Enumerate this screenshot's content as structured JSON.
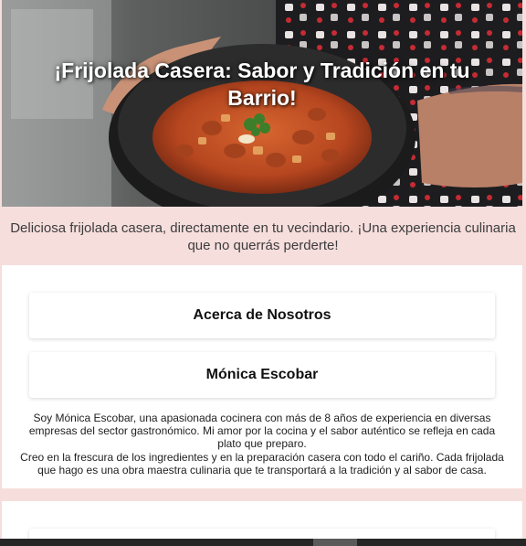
{
  "hero": {
    "title": "¡Frijolada Casera: Sabor y Tradición en tu Barrio!",
    "image_icon": "bowl-of-beans-photo"
  },
  "tagline": "Deliciosa frijolada casera, directamente en tu vecindario. ¡Una experiencia culinaria que no querrás perderte!",
  "sections": {
    "about_label": "Acerca de Nosotros",
    "chef_label": "Mónica Escobar"
  },
  "bio": {
    "p1": "Soy Mónica Escobar, una apasionada cocinera con más de 8 años de experiencia en diversas empresas del sector gastronómico. Mi amor por la cocina y el sabor auténtico se refleja en cada plato que preparo.",
    "p2": "Creo en la frescura de los ingredientes y en la preparación casera con todo el cariño. Cada frijolada que hago es una obra maestra culinaria que te transportará a la tradición y al sabor de casa."
  },
  "colors": {
    "page_background": "#f6dedd",
    "panel_background": "#ffffff",
    "hero_text": "#ffffff"
  }
}
